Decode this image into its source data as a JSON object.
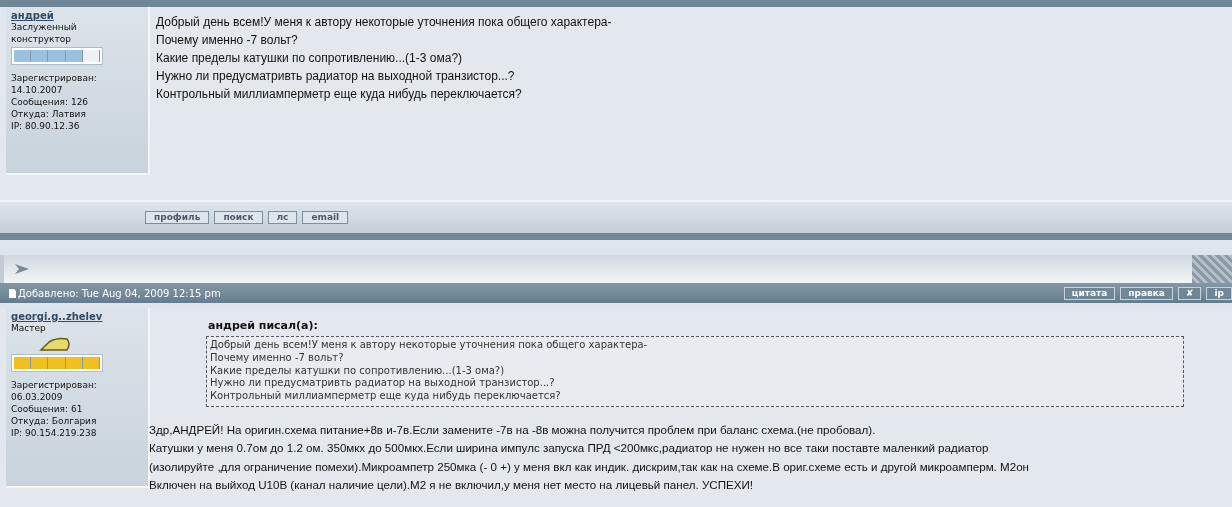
{
  "posts": [
    {
      "author": "андрей",
      "rank": "Заслуженный конструктор",
      "level": 0.8,
      "color": "#9cc0e0",
      "badge": false,
      "stats": [
        "Зарегистрирован:",
        "14.10.2007",
        "Сообщения: 126",
        "Откуда: Латвия",
        "IP: 80.90.12.36"
      ],
      "message": [
        "Добрый день всем!У меня к автору некоторые уточнения пока общего характера-",
        "Почему именно -7 вольт?",
        "Какие пределы катушки по сопротивлению...(1-3 ома?)",
        "Нужно ли предусматривть радиатор на выходной транзистор...?",
        "Контрольный миллиамперметр еще куда нибудь переключается?"
      ],
      "buttons": [
        "профиль",
        "поиск",
        "лс",
        "email"
      ]
    },
    {
      "header": "Добавлено: Tue Aug 04, 2009 12:15 pm",
      "actions": [
        "цитата",
        "правка",
        "✘",
        "ip"
      ],
      "author": "georgi.g..zhelev",
      "rank": "Мастер",
      "level": 1,
      "color": "#f0c020",
      "badge": true,
      "stats": [
        "Зарегистрирован:",
        "06.03.2009",
        "Сообщения: 61",
        "Откуда: Болгария",
        "IP: 90.154.219.238"
      ],
      "quote": {
        "title": "андрей писал(а):",
        "lines": [
          "Добрый день всем!У меня к автору некоторые уточнения пока общего характера-",
          "Почему именно -7 вольт?",
          "Какие пределы катушки по сопротивлению...(1-3 ома?)",
          "Нужно ли предусматривть радиатор на выходной транзистор...?",
          "Контрольный миллиамперметр еще куда нибудь переключается?"
        ]
      },
      "message": [
        "Здр,АНДРЕЙ! На оригин.схема питание+8в и-7в.Если замените -7в на -8в можна получится проблем при баланс схема.(не пробовал).",
        "Катушки у меня 0.7ом до 1.2 ом. 350мкх до 500мкх.Если ширина импулс запуска ПРД <200мкс,радиатор не нужен но все таки поставте маленкий радиатор",
        "(изолируйте ,для ограничение помехи).Микроампетр 250мка (- 0 +) у меня вкл как индик. дискрим,так как на схеме.В ориг.схеме есть и другой микроамперм. М2он",
        "Включен на выйход U10В (канал наличие цели).М2 я не включил,у меня нет место на лицевьй панел. УСПЕХИ!"
      ]
    }
  ]
}
